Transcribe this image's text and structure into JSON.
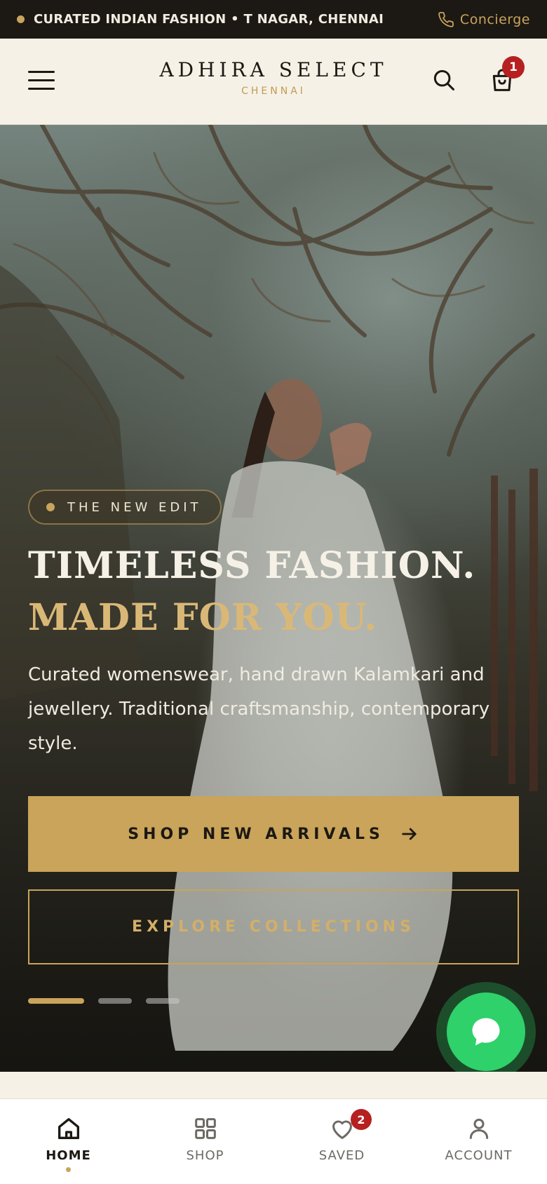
{
  "announcement": {
    "text": "CURATED INDIAN FASHION • T NAGAR, CHENNAI",
    "concierge_label": "Concierge",
    "icon": "phone-icon"
  },
  "header": {
    "brand_name": "ADHIRA SELECT",
    "brand_location": "CHENNAI",
    "cart_count": "1",
    "icons": [
      "menu-icon",
      "search-icon",
      "shopping-bag-icon"
    ]
  },
  "hero": {
    "tag": "THE NEW EDIT",
    "headline_line1": "TIMELESS FASHION.",
    "headline_line2": "MADE FOR YOU.",
    "description": "Curated womenswear, hand drawn Kalamkari and jewellery. Traditional craftsmanship, contemporary style.",
    "primary_cta": "SHOP NEW ARRIVALS",
    "secondary_cta": "EXPLORE COLLECTIONS",
    "slides_total": 3,
    "active_slide": 1
  },
  "chat": {
    "icon": "chat-bubble-icon"
  },
  "bottom_nav": {
    "items": [
      {
        "label": "HOME",
        "icon": "home-icon",
        "active": true
      },
      {
        "label": "SHOP",
        "icon": "grid-icon",
        "active": false
      },
      {
        "label": "SAVED",
        "icon": "heart-icon",
        "active": false,
        "badge": "2"
      },
      {
        "label": "ACCOUNT",
        "icon": "user-icon",
        "active": false
      }
    ]
  },
  "colors": {
    "gold": "#c9a45a",
    "dark": "#1c1813",
    "cream": "#f6f1e7",
    "badge_red": "#b62020",
    "chat_green": "#2fd16a"
  }
}
